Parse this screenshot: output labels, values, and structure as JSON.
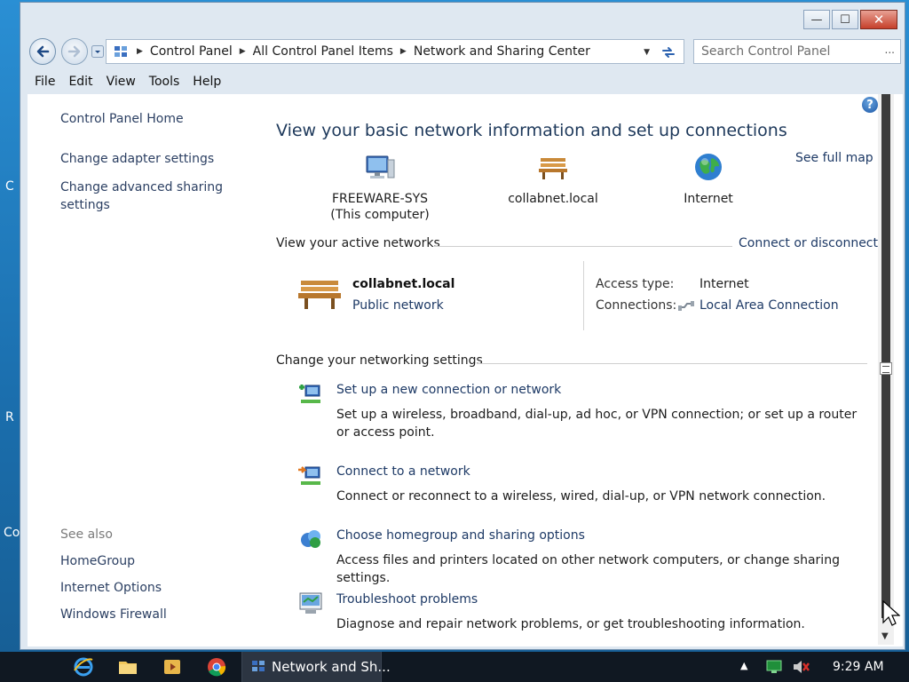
{
  "window": {
    "controls": {
      "minimize": "—",
      "maximize": "☐",
      "close": "✕"
    }
  },
  "address": {
    "breadcrumbs": [
      "Control Panel",
      "All Control Panel Items",
      "Network and Sharing Center"
    ],
    "search_placeholder": "Search Control Panel"
  },
  "menu": [
    "File",
    "Edit",
    "View",
    "Tools",
    "Help"
  ],
  "sidebar": {
    "links": [
      "Control Panel Home",
      "Change adapter settings",
      "Change advanced sharing settings"
    ],
    "see_also_title": "See also",
    "see_also": [
      "HomeGroup",
      "Internet Options",
      "Windows Firewall"
    ]
  },
  "main": {
    "title": "View your basic network information and set up connections",
    "see_full_map": "See full map",
    "map_nodes": [
      {
        "label": "FREEWARE-SYS",
        "sublabel": "(This computer)",
        "icon": "computer-icon"
      },
      {
        "label": "collabnet.local",
        "sublabel": "",
        "icon": "bench-icon"
      },
      {
        "label": "Internet",
        "sublabel": "",
        "icon": "globe-icon"
      }
    ],
    "active_networks": {
      "heading": "View your active networks",
      "connect_link": "Connect or disconnect",
      "name": "collabnet.local",
      "type": "Public network",
      "access_type_label": "Access type:",
      "access_type_value": "Internet",
      "connections_label": "Connections:",
      "connections_value": "Local Area Connection"
    },
    "change_settings": {
      "heading": "Change your networking settings",
      "tasks": [
        {
          "title": "Set up a new connection or network",
          "desc": "Set up a wireless, broadband, dial-up, ad hoc, or VPN connection; or set up a router or access point.",
          "icon": "new-connection-icon"
        },
        {
          "title": "Connect to a network",
          "desc": "Connect or reconnect to a wireless, wired, dial-up, or VPN network connection.",
          "icon": "connect-network-icon"
        },
        {
          "title": "Choose homegroup and sharing options",
          "desc": "Access files and printers located on other network computers, or change sharing settings.",
          "icon": "homegroup-icon"
        },
        {
          "title": "Troubleshoot problems",
          "desc": "Diagnose and repair network problems, or get troubleshooting information.",
          "icon": "troubleshoot-icon"
        }
      ]
    }
  },
  "desktop_fragments": [
    "C",
    "R",
    "Co"
  ],
  "taskbar": {
    "active_task_label": "Network and Sh...",
    "clock": "9:29 AM"
  },
  "colors": {
    "link": "#1e3a66",
    "title": "#1e395b",
    "taskbar": "#101822",
    "window_frame": "#dfe8f1"
  }
}
